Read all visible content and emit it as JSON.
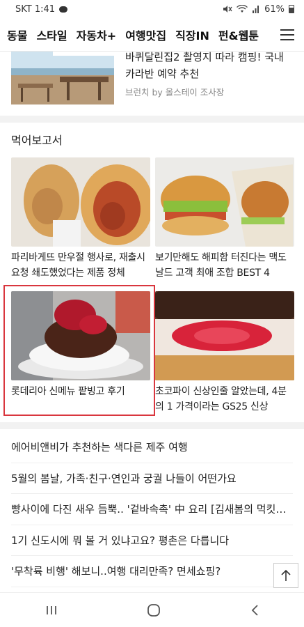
{
  "status": {
    "carrier_time": "SKT 1:41",
    "battery": "61%"
  },
  "nav": {
    "items": [
      "동물",
      "스타일",
      "자동차+",
      "여행맛집",
      "직장IN",
      "펀&웹툰"
    ]
  },
  "top_article": {
    "title": "바퀴달린집2 촬영지 따라 캠핑! 국내 카라반 예약 추천",
    "source": "브런치 by 올스테이 조사장"
  },
  "section": {
    "title": "먹어보고서"
  },
  "cards": [
    {
      "title": "파리바게뜨 만우절 행사로, 재출시 요청 쇄도했었다는 제품 정체"
    },
    {
      "title": "보기만해도 해피함 터진다는 맥도날드 고객 최애 조합 BEST 4"
    },
    {
      "title": "롯데리아 신메뉴 팥빙고 후기"
    },
    {
      "title": "초코파이 신상인줄 알았는데, 4분의 1 가격이라는 GS25 신상"
    }
  ],
  "list": [
    "에어비앤비가 추천하는 색다른 제주 여행",
    "5월의 봄날, 가족·친구·연인과 궁궐 나들이 어떤가요",
    "빵사이에 다진 새우 듬뿍.. '겉바속촉' 中 요리 [김새봄의 먹킷리스트]",
    "1기 신도시에 뭐 볼 거 있냐고요? 평촌은 다릅니다",
    "'무착륙 비행' 해보니..여행 대리만족? 면세쇼핑?"
  ]
}
